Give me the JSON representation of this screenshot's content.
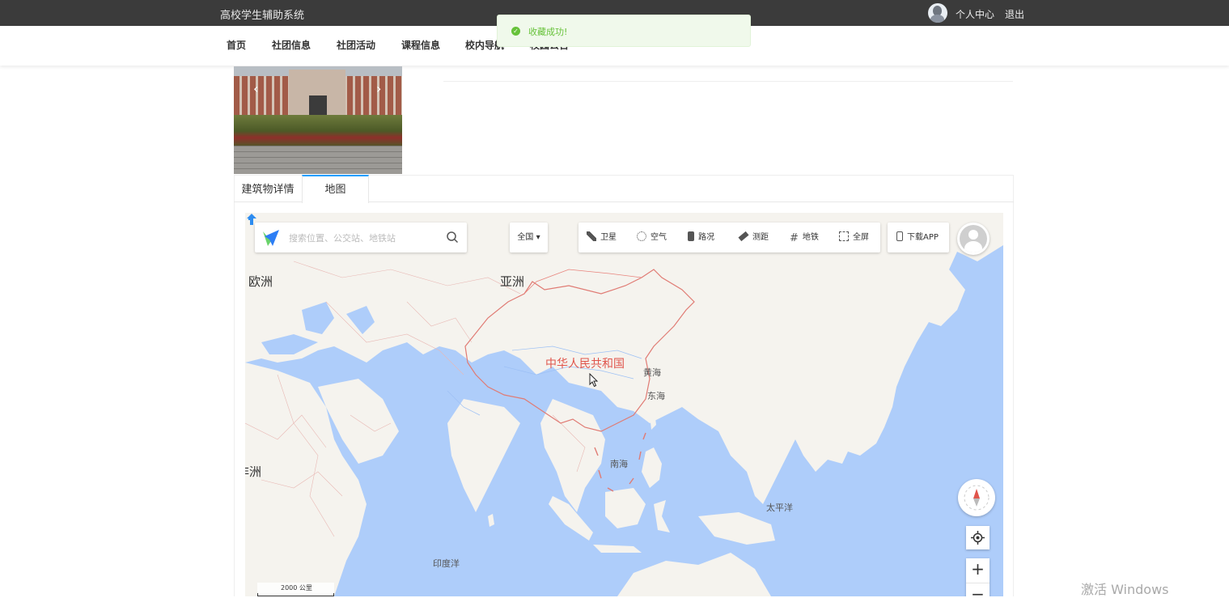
{
  "header": {
    "brand": "高校学生辅助系统",
    "user_center": "个人中心",
    "logout": "退出"
  },
  "nav": {
    "items": [
      "首页",
      "社团信息",
      "社团活动",
      "课程信息",
      "校内导航",
      "校园公告"
    ]
  },
  "toast": {
    "message": "收藏成功!"
  },
  "tabs": {
    "items": [
      "建筑物详情",
      "地图"
    ],
    "active": "地图"
  },
  "map": {
    "search_placeholder": "搜索位置、公交站、地铁站",
    "city": "全国",
    "tools": [
      "卫星",
      "空气",
      "路况",
      "测距",
      "地铁",
      "全屏"
    ],
    "download_app": "下载APP",
    "labels": {
      "europe": "欧洲",
      "asia": "亚洲",
      "africa": "非洲",
      "china": "中华人民共和国",
      "yellow_sea": "黄海",
      "east_sea": "东海",
      "south_sea": "南海",
      "pacific": "太平洋",
      "indian_ocean": "印度洋"
    },
    "scale": "2000 公里",
    "zoom_in": "+",
    "zoom_out": "−"
  },
  "system": {
    "watermark": "激活 Windows"
  },
  "colors": {
    "topbar": "#3b3b3b",
    "ocean": "#aecdfa",
    "land": "#f5f3ee",
    "border": "#e8837c",
    "accent": "#1e9fff",
    "success": "#67c23a"
  }
}
